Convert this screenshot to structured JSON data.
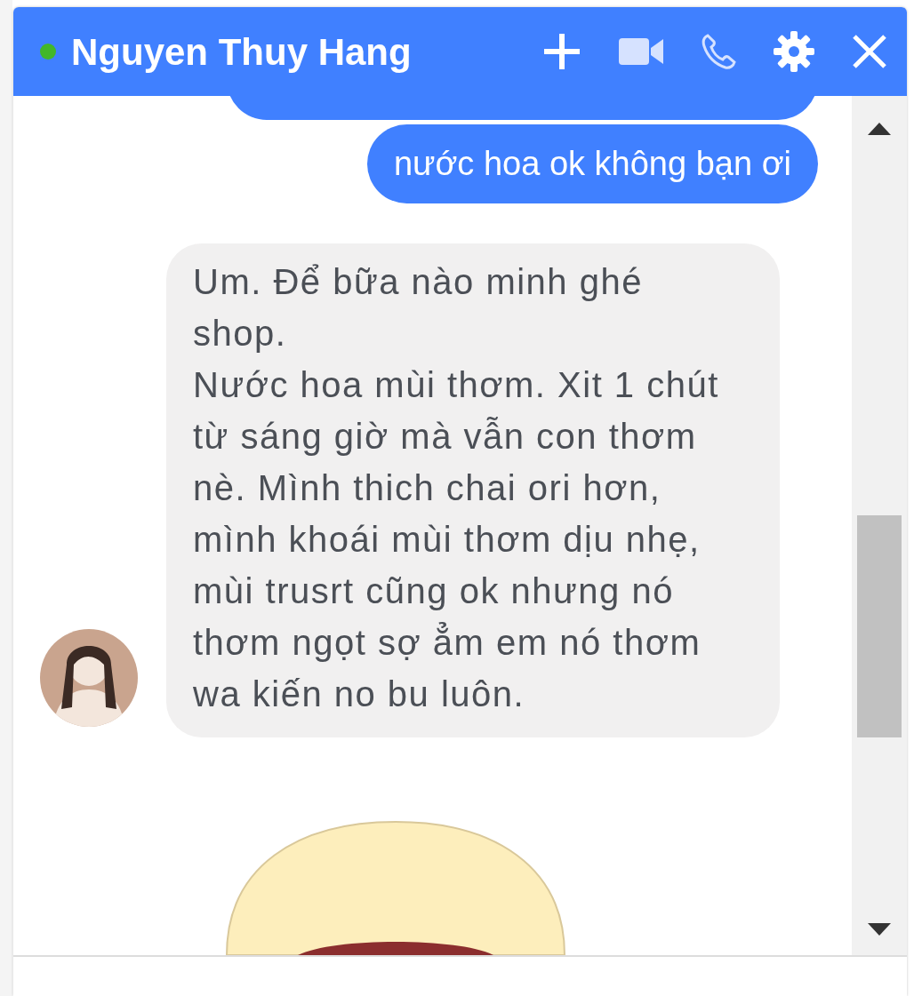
{
  "chat": {
    "contact": {
      "name": "Nguyen Thuy Hang",
      "online": true
    },
    "header_actions": [
      {
        "kind": "add"
      },
      {
        "kind": "video"
      },
      {
        "kind": "call"
      },
      {
        "kind": "settings"
      },
      {
        "kind": "close"
      }
    ],
    "messages": [
      {
        "kind": "sent_partial"
      },
      {
        "kind": "sent",
        "text": "nước hoa ok không bạn ơi"
      },
      {
        "kind": "received",
        "text": "Um. Để bữa nào minh ghé shop.\nNước hoa mùi thơm. Xit 1 chút từ sáng giờ mà vẫn con thơm nè. Mình thich chai ori hơn, mình khoái mùi thơm dịu nhẹ, mùi trusrt cũng ok nhưng nó thơm ngọt sợ ẳm em nó thơm wa kiến no bu luôn.",
        "avatar": true
      },
      {
        "kind": "sticker"
      }
    ]
  }
}
